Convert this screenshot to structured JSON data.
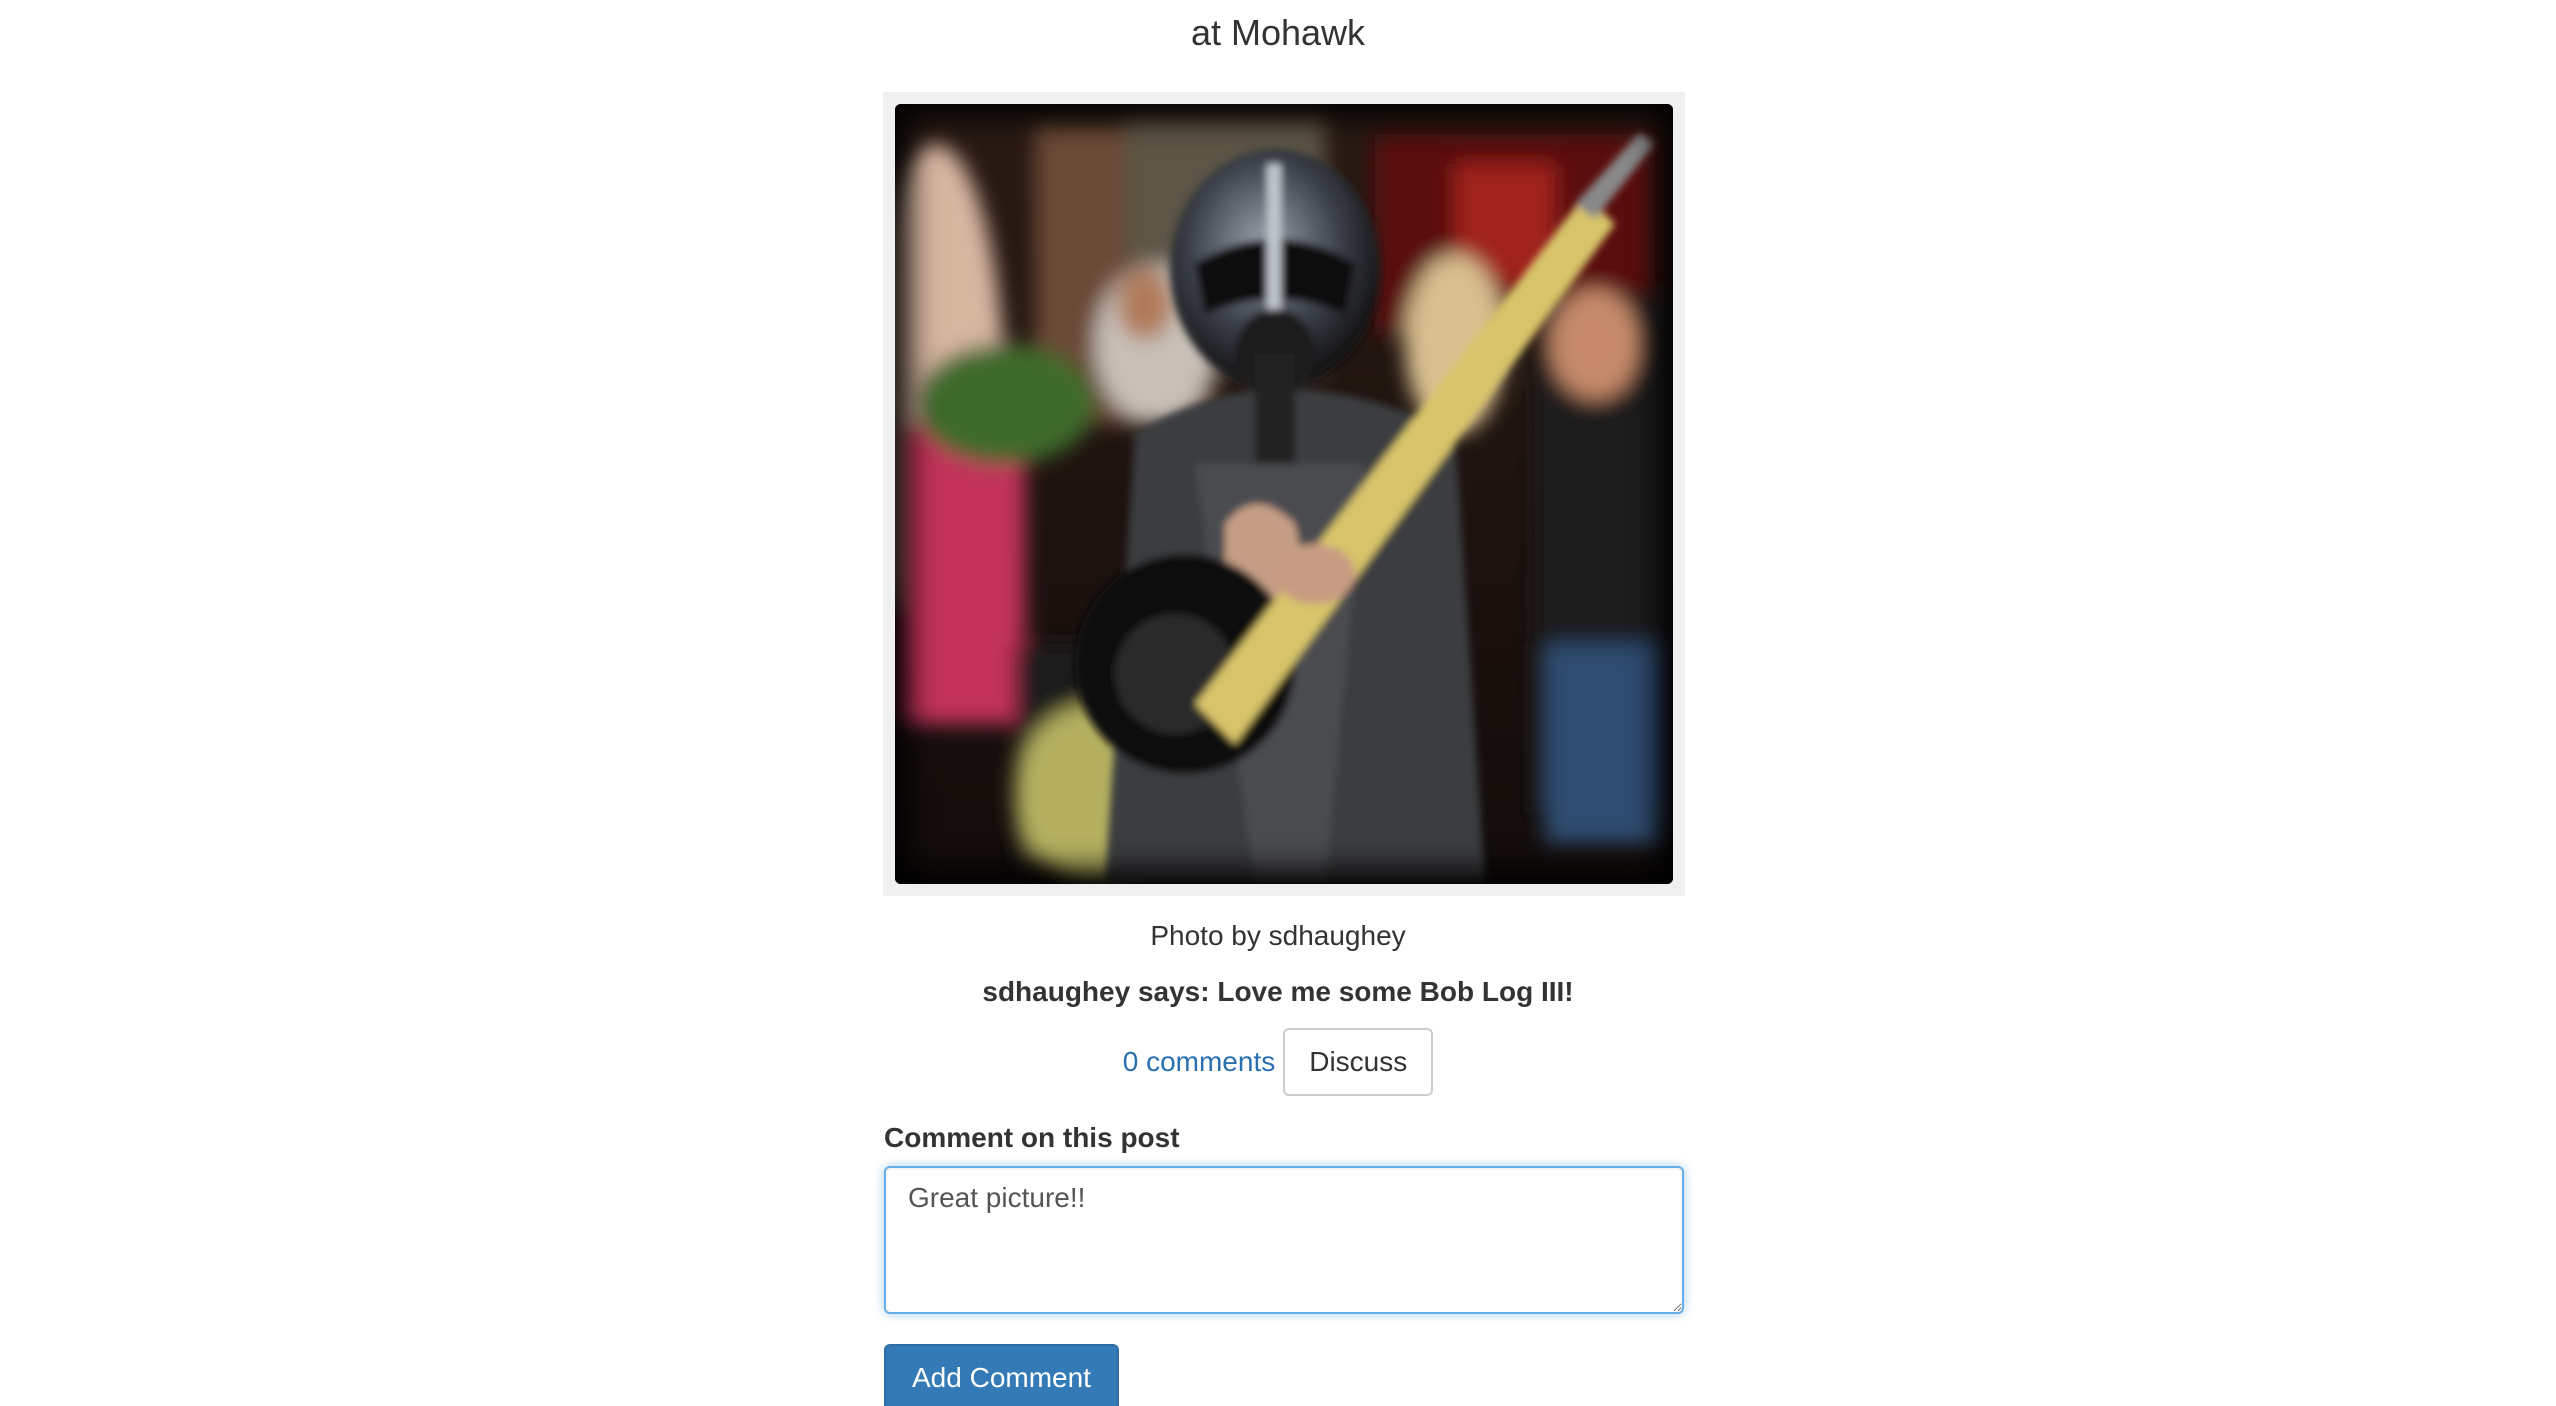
{
  "post": {
    "title": "at Mohawk",
    "photo_credit": "Photo by sdhaughey",
    "message": "sdhaughey says: Love me some Bob Log III!",
    "comments_link": "0 comments",
    "discuss_label": "Discuss"
  },
  "comment_form": {
    "label": "Comment on this post",
    "value": "Great picture!!",
    "submit_label": "Add Comment"
  },
  "colors": {
    "link": "#2a6fb0",
    "primary_button": "#337ab7",
    "focus_border": "#66afe9"
  }
}
